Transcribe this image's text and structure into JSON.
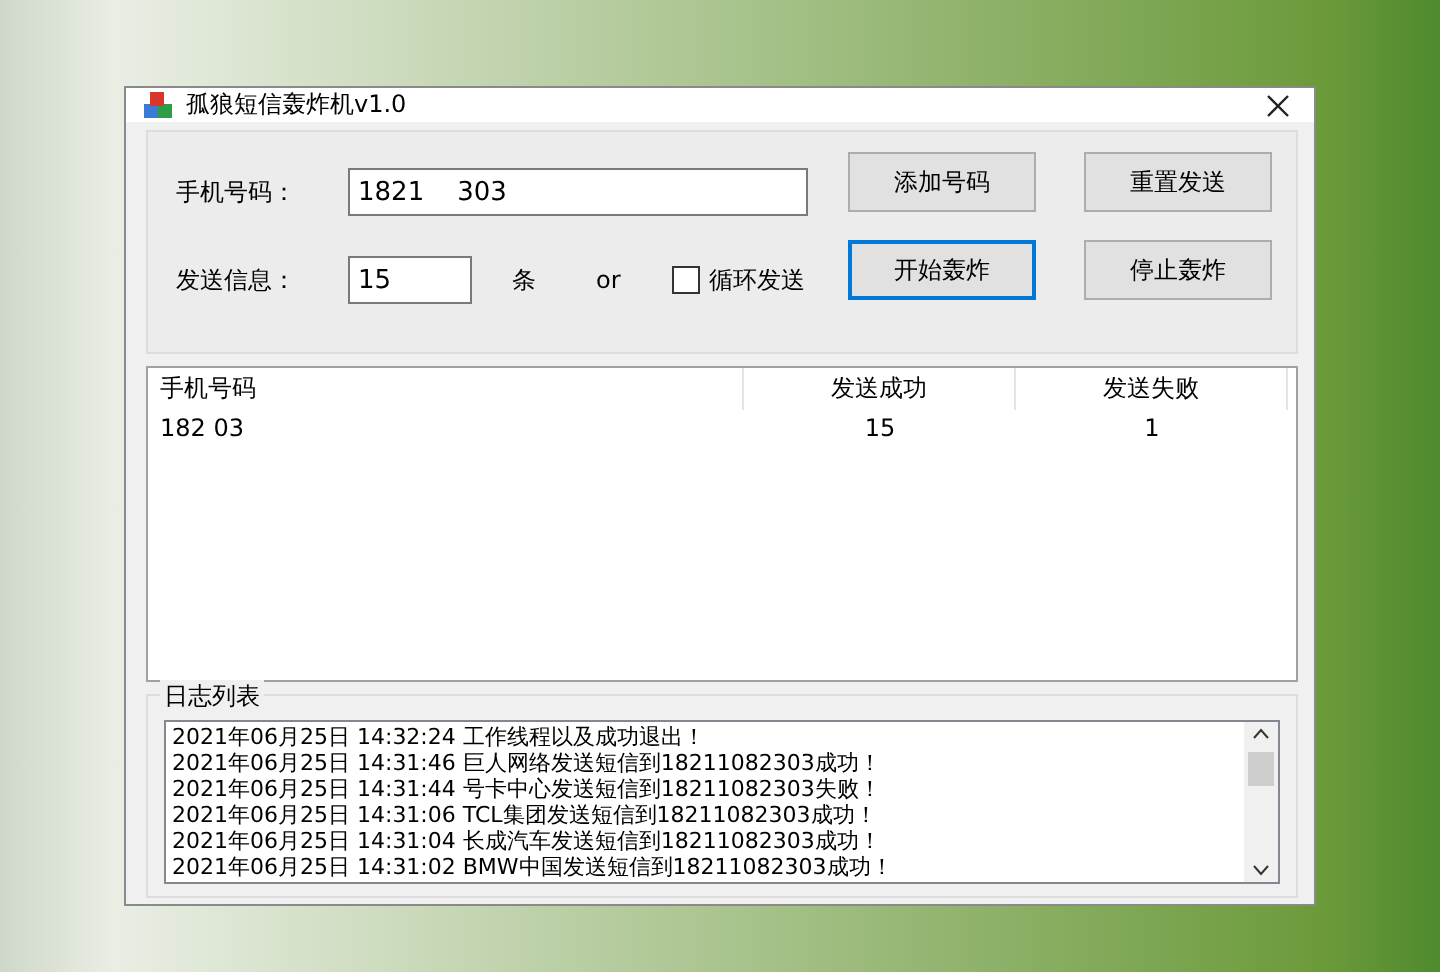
{
  "window": {
    "title": "孤狼短信轰炸机v1.0"
  },
  "form": {
    "phone_label": "手机号码：",
    "phone_value": "1821    303",
    "message_label": "发送信息：",
    "count_value": "15",
    "count_unit": "条",
    "or_text": "or",
    "loop": {
      "label": "循环发送",
      "checked": false
    }
  },
  "buttons": [
    {
      "label": "添加号码",
      "focused": false
    },
    {
      "label": "重置发送",
      "focused": false
    },
    {
      "label": "开始轰炸",
      "focused": true
    },
    {
      "label": "停止轰炸",
      "focused": false
    }
  ],
  "table": {
    "columns": [
      "手机号码",
      "发送成功",
      "发送失败"
    ],
    "rows": [
      [
        "182    03",
        "15",
        "1"
      ]
    ]
  },
  "log": {
    "title": "日志列表",
    "lines": [
      "2021年06月25日 14:32:24  工作线程以及成功退出！",
      "2021年06月25日 14:31:46  巨人网络发送短信到18211082303成功！",
      "2021年06月25日 14:31:44  号卡中心发送短信到18211082303失败！",
      "2021年06月25日 14:31:06  TCL集团发送短信到18211082303成功！",
      "2021年06月25日 14:31:04  长成汽车发送短信到18211082303成功！",
      "2021年06月25日 14:31:02  BMW中国发送短信到18211082303成功！"
    ]
  }
}
